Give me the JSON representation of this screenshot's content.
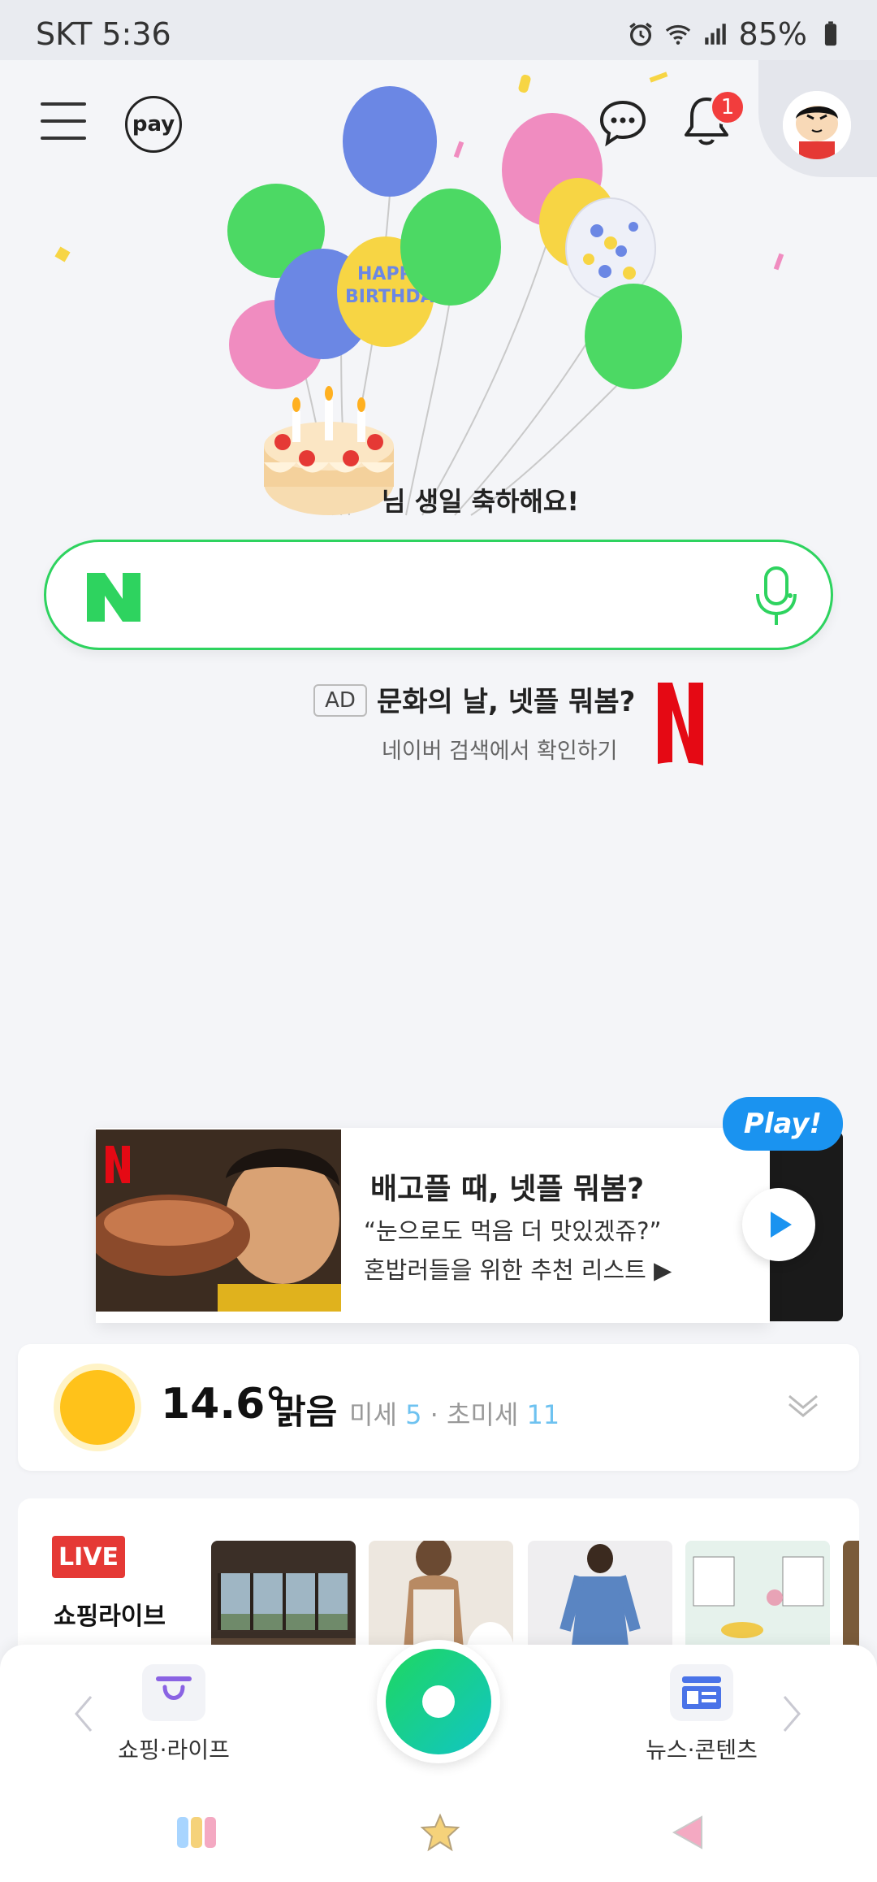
{
  "status_bar": {
    "carrier_time": "SKT 5:36",
    "battery": "85%"
  },
  "header": {
    "pay_label": "pay",
    "notification_count": "1"
  },
  "birthday": {
    "message": "님 생일 축하해요!"
  },
  "search": {
    "placeholder": ""
  },
  "ad": {
    "badge": "AD",
    "title": "문화의 날, 넷플 뭐봄?",
    "subtitle": "네이버 검색에서 확인하기"
  },
  "promo": {
    "tag": "Play!",
    "title": "배고플 때, 넷플 뭐봄?",
    "line1": "“눈으로도 먹음 더 맛있겠쥬?”",
    "line2": "혼밥러들을 위한 추천 리스트 ▶"
  },
  "weather": {
    "temperature": "14.6°",
    "condition": "맑음",
    "fine_dust_label": "미세",
    "fine_dust_value": "5",
    "separator": "·",
    "ultra_fine_label": "초미세",
    "ultra_fine_value": "11"
  },
  "shopping_live": {
    "badge": "LIVE",
    "title": "쇼핑라이브"
  },
  "bottom_nav": {
    "left_label": "쇼핑·라이프",
    "right_label": "뉴스·콘텐츠"
  },
  "colors": {
    "brand_green": "#2ed35f",
    "live_red": "#e53935",
    "badge_red": "#f23d3d",
    "play_blue": "#1a93f0",
    "dust_blue": "#6ec2f0",
    "sun_yellow": "#ffc21a"
  },
  "icons": [
    "menu-icon",
    "pay-icon",
    "chat-icon",
    "bell-icon",
    "avatar",
    "naver-n-icon",
    "mic-icon",
    "netflix-icon",
    "play-icon",
    "sun-icon",
    "chevron-down-icon",
    "shopping-bag-icon",
    "news-icon",
    "green-dot-button",
    "recents-icon",
    "home-star-icon",
    "back-icon"
  ]
}
